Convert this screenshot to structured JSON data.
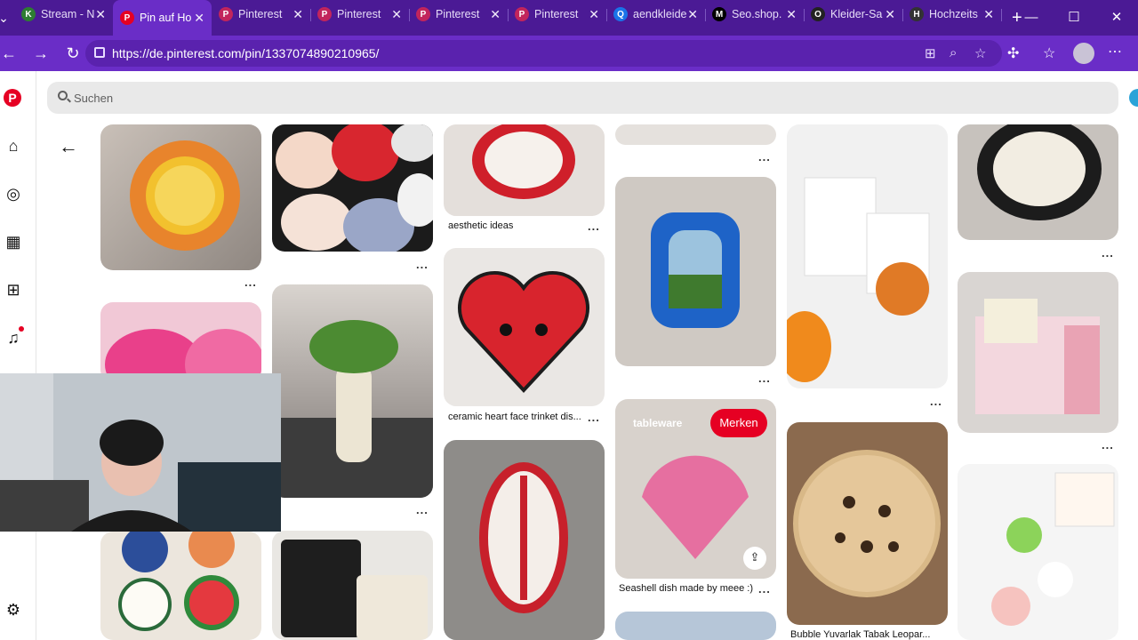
{
  "browser": {
    "tabs": [
      {
        "label": "Stream - N",
        "favicon": "K",
        "favcolor": "#2e7d32",
        "active": false
      },
      {
        "label": "Pin auf Ho",
        "favicon": "P",
        "favcolor": "#e60023",
        "active": true
      },
      {
        "label": "Pinterest",
        "favicon": "P",
        "favcolor": "#c2255c",
        "active": false
      },
      {
        "label": "Pinterest",
        "favicon": "P",
        "favcolor": "#c2255c",
        "active": false
      },
      {
        "label": "Pinterest",
        "favicon": "P",
        "favcolor": "#c2255c",
        "active": false
      },
      {
        "label": "Pinterest",
        "favicon": "P",
        "favcolor": "#c2255c",
        "active": false
      },
      {
        "label": "aendkleide",
        "favicon": "Q",
        "favcolor": "#1a73e8",
        "active": false
      },
      {
        "label": "Seo.shop.",
        "favicon": "M",
        "favcolor": "#000000",
        "active": false
      },
      {
        "label": "Kleider-Sa",
        "favicon": "O",
        "favcolor": "#222222",
        "active": false
      },
      {
        "label": "Hochzeits",
        "favicon": "H",
        "favcolor": "#333333",
        "active": false
      }
    ],
    "url": "https://de.pinterest.com/pin/1337074890210965/",
    "accent": "#6a2dc7"
  },
  "search": {
    "placeholder": "Suchen"
  },
  "pins": {
    "col3_caption1": "aesthetic ideas",
    "col3_caption2": "ceramic heart face trinket dis...",
    "col4_caption": "Seashell dish made by meee :)",
    "col5_caption": "Bubble Yuvarlak Tabak Leopar...",
    "board_selector": "tableware",
    "save_button": "Merken",
    "dots": "..."
  }
}
